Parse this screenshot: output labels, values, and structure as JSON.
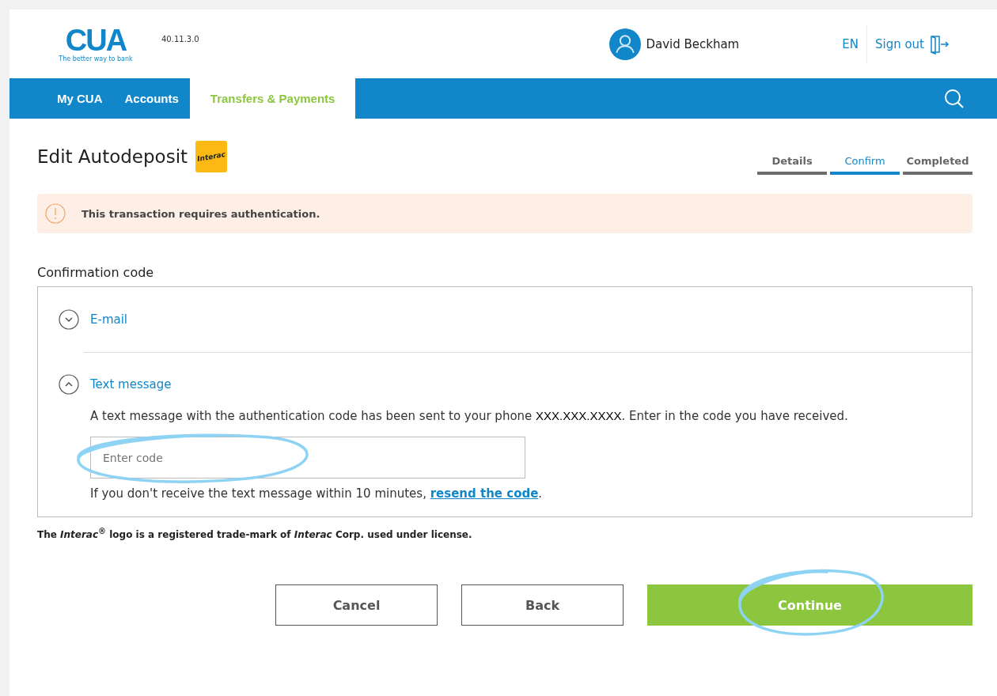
{
  "header": {
    "logo": {
      "name": "CUA",
      "tagline": "The better way to bank"
    },
    "version": "40.11.3.0",
    "user": "David Beckham",
    "language": "EN",
    "sign_out": "Sign out"
  },
  "nav": {
    "tabs": [
      {
        "label": "My CUA",
        "selected": false
      },
      {
        "label": "Accounts",
        "selected": false
      },
      {
        "label": "Transfers & Payments",
        "selected": true
      }
    ]
  },
  "page": {
    "title": "Edit Autodeposit",
    "badge": "Interac",
    "steps": [
      {
        "label": "Details",
        "selected": false
      },
      {
        "label": "Confirm",
        "selected": true
      },
      {
        "label": "Completed",
        "selected": false
      }
    ],
    "alert": "This transaction requires authentication.",
    "section_title": "Confirmation code",
    "methods": [
      {
        "label": "E-mail",
        "expanded": false
      },
      {
        "label": "Text message",
        "expanded": true,
        "message": "A text message with the authentication code has been sent to your phone **XXX.XXX.XXXX**. Enter in the code you have received.",
        "field": {
          "placeholder": "Enter code",
          "circled": true
        },
        "resend": {
          "text_before": "If you don't receive the text message within 10 minutes, ",
          "link": "resend the code",
          "text_after": "."
        }
      }
    ],
    "footnote": "The *Interac*$^{®}$ logo is a registered trade-mark of *Interac* Corp. used under license.",
    "buttons": [
      {
        "label": "Cancel",
        "kind": "secondary",
        "circled": false
      },
      {
        "label": "Back",
        "kind": "secondary",
        "circled": false
      },
      {
        "label": "Continue",
        "kind": "primary",
        "circled": true
      }
    ]
  }
}
